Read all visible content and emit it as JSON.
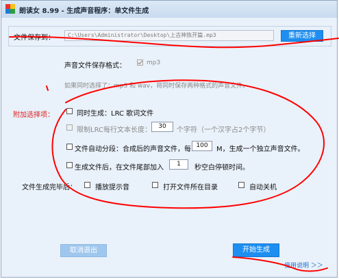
{
  "window": {
    "title": "朗读女 8.99 - 生成声音程序：单文件生成"
  },
  "save": {
    "label": "文件保存到：",
    "path": "C:\\Users\\Administrator\\Desktop\\上古神族开篇.mp3",
    "reselect_button": "重新选择"
  },
  "format": {
    "label": "声音文件保存格式：",
    "option": "mp3",
    "note": "如果同时选择了：mp3 和 wav，将同时保存两种格式的声音文件。"
  },
  "extras": {
    "label": "附加选择项：",
    "lrc_label": "同时生成：LRC 歌词文件",
    "lrc_limit_prefix": "限制LRC每行文本长度：",
    "lrc_limit_value": "30",
    "lrc_limit_suffix": "个字符（一个汉字占2个字节）",
    "split_prefix": "文件自动分段：合成后的声音文件，每",
    "split_value": "100",
    "split_suffix": "M，生成一个独立声音文件。",
    "silence_prefix": "生成文件后，在文件尾部加入",
    "silence_value": "1",
    "silence_suffix": "秒空白停顿时间。"
  },
  "after": {
    "label": "文件生成完毕后：",
    "options": [
      "播放提示音",
      "打开文件所在目录",
      "自动关机"
    ]
  },
  "buttons": {
    "cancel": "取消退出",
    "start": "开始生成",
    "help": "使用说明 ＞＞"
  },
  "colors": {
    "accent_blue": "#1e8ef0",
    "annotation_red": "#ff0000",
    "extras_label_red": "#e02020"
  }
}
